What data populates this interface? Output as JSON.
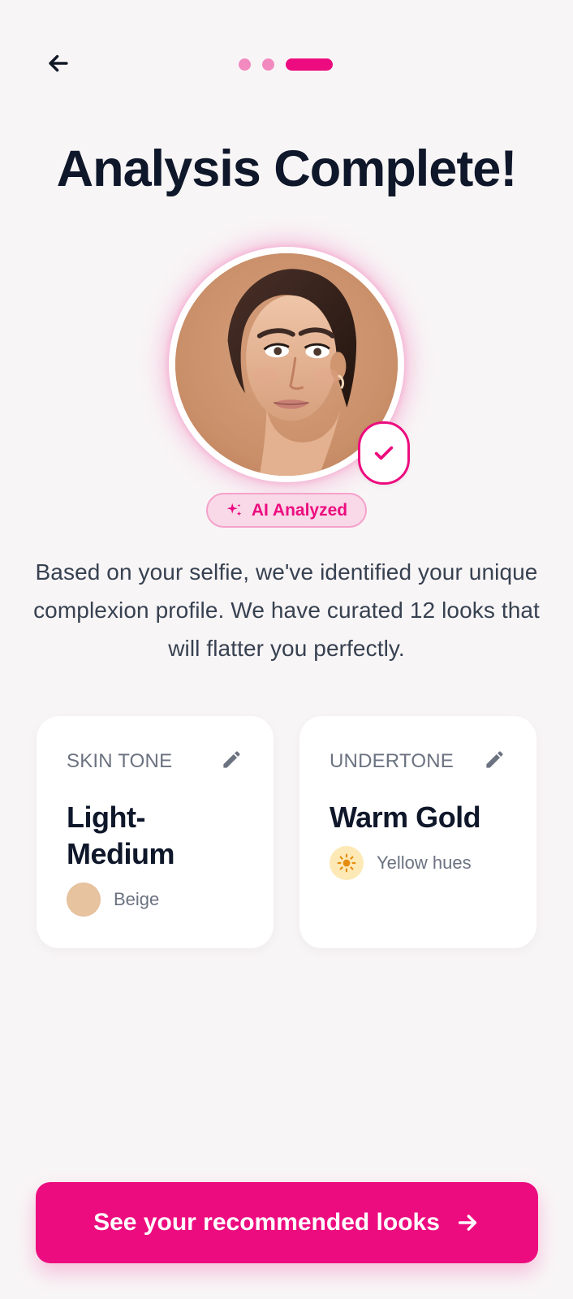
{
  "header": {
    "title": "Analysis Complete!"
  },
  "profile": {
    "badge_label": "AI Analyzed",
    "description": "Based on your selfie, we've identified your unique complexion profile. We have curated 12 looks that will flatter you perfectly."
  },
  "cards": {
    "skin_tone": {
      "label": "SKIN TONE",
      "value": "Light-Medium",
      "sub_label": "Beige",
      "swatch_color": "#e8c39f"
    },
    "undertone": {
      "label": "UNDERTONE",
      "value": "Warm Gold",
      "sub_label": "Yellow hues",
      "icon": "sun-icon",
      "icon_bg": "#fde9b6",
      "icon_color": "#e58b0f"
    }
  },
  "progress": {
    "current_step": 3,
    "total_steps": 3
  },
  "cta": {
    "label": "See your recommended looks"
  },
  "colors": {
    "brand": "#ec0c7f",
    "background": "#f8f5f6",
    "text_primary": "#0f172a",
    "text_secondary": "#6b7280"
  }
}
